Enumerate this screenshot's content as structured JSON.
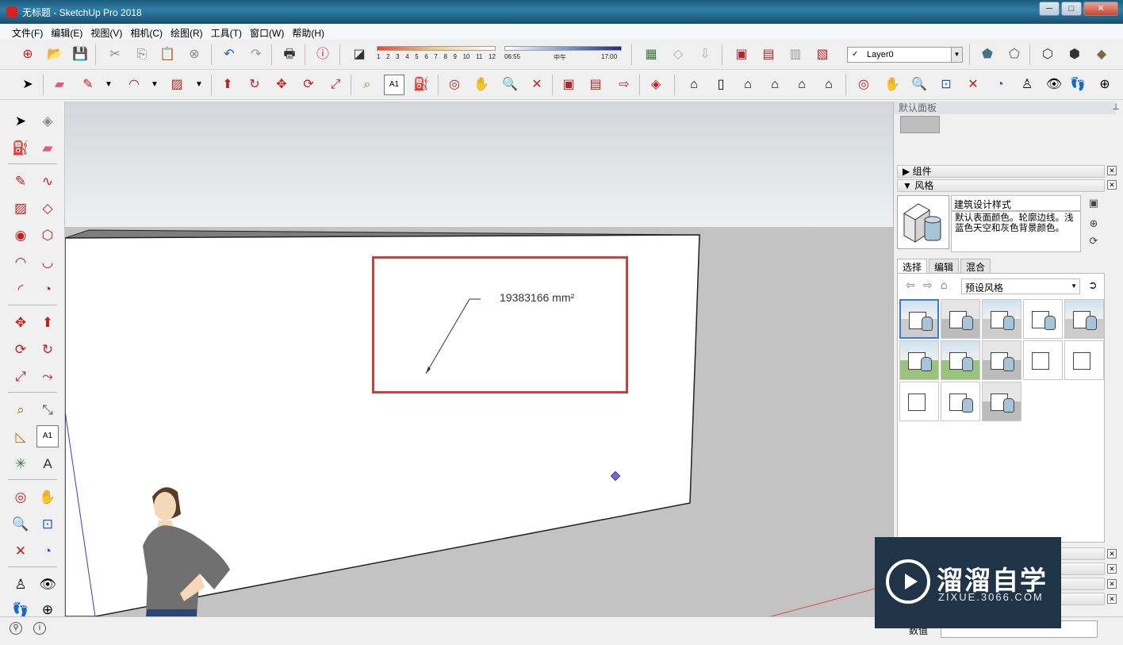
{
  "window": {
    "title": "无标题 - SketchUp Pro 2018",
    "minimize": "─",
    "maximize": "□",
    "close": "✕"
  },
  "menu": [
    "文件(F)",
    "编辑(E)",
    "视图(V)",
    "相机(C)",
    "绘图(R)",
    "工具(T)",
    "窗口(W)",
    "帮助(H)"
  ],
  "toolbar": {
    "shadow_scale": [
      "1",
      "2",
      "3",
      "4",
      "5",
      "6",
      "7",
      "8",
      "9",
      "10",
      "11",
      "12"
    ],
    "time_start": "06:55",
    "time_mid": "中午",
    "time_end": "17:00",
    "layer": "Layer0",
    "layer_check": "✓"
  },
  "viewport": {
    "area_label": "19383166 mm²"
  },
  "right_panel": {
    "title": "默认面板",
    "pin": "📌",
    "components_header": "组件",
    "styles_header": "风格",
    "style_name": "建筑设计样式",
    "style_description": "默认表面颜色。轮廓边线。浅蓝色天空和灰色背景颜色。",
    "tabs": [
      "选择",
      "编辑",
      "混合"
    ],
    "style_collection": "预设风格"
  },
  "statusbar": {
    "measure_label": "数值"
  },
  "watermark": {
    "title": "溜溜自学",
    "url": "ZIXUE.3066.COM"
  },
  "colors": {
    "titlebar": "#2e7ea6",
    "highlight_box": "#d9393a",
    "sky": "#dfe1e4",
    "ground": "#c2c2c2"
  }
}
